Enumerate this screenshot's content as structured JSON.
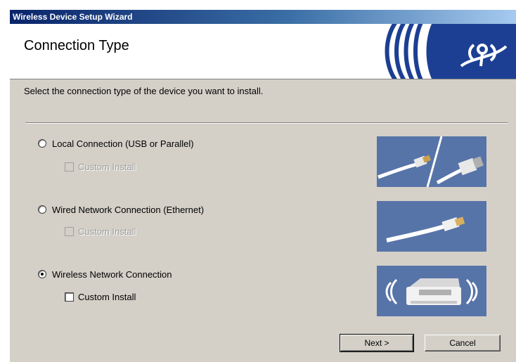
{
  "window": {
    "title": "Wireless Device Setup Wizard"
  },
  "header": {
    "title": "Connection Type"
  },
  "instruction": "Select the connection type of the device you want to install.",
  "options": [
    {
      "label": "Local Connection (USB or Parallel)",
      "selected": false,
      "custom_install_label": "Custom Install",
      "custom_install_enabled": false,
      "custom_install_checked": false,
      "image_icon": "usb-parallel-cables-icon"
    },
    {
      "label": "Wired Network Connection (Ethernet)",
      "selected": false,
      "custom_install_label": "Custom Install",
      "custom_install_enabled": false,
      "custom_install_checked": false,
      "image_icon": "ethernet-cable-icon"
    },
    {
      "label": "Wireless Network Connection",
      "selected": true,
      "custom_install_label": "Custom Install",
      "custom_install_enabled": true,
      "custom_install_checked": false,
      "image_icon": "wireless-printer-icon"
    }
  ],
  "buttons": {
    "next": "Next >",
    "cancel": "Cancel"
  },
  "colors": {
    "titlebar": "#0a246a",
    "dialog_bg": "#d4d0c8",
    "picture_bg": "#5774a8",
    "logo_blue": "#1c3f94"
  }
}
